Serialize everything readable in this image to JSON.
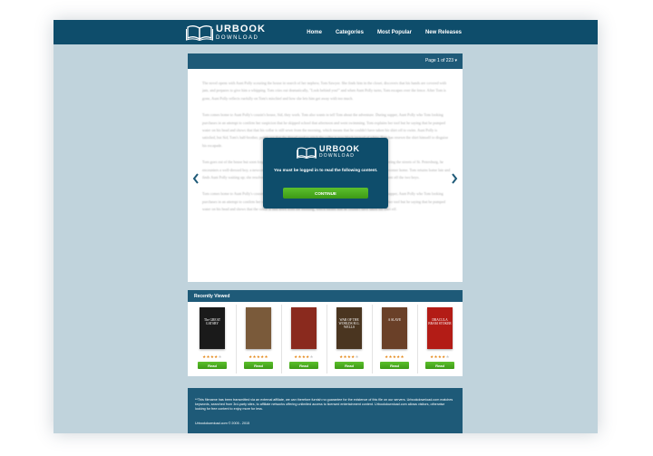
{
  "brand": {
    "line1": "URBOOK",
    "line2": "DOWNLOAD"
  },
  "nav": [
    {
      "label": "Home"
    },
    {
      "label": "Categories"
    },
    {
      "label": "Most Popular"
    },
    {
      "label": "New Releases"
    }
  ],
  "reader": {
    "pager": "Page 1 of 223 ▾",
    "paragraphs": [
      "The novel opens with Aunt Polly scouring the house in search of her nephew, Tom Sawyer. She finds him in the closet, discovers that his hands are covered with jam, and prepares to give him a whipping. Tom cries out dramatically, \"Look behind you!\" and when Aunt Polly turns, Tom escapes over the fence. After Tom is gone, Aunt Polly reflects ruefully on Tom's mischief and how she lets him get away with too much.",
      "Tom comes home to Aunt Polly's cousin's house, Sid, they work. Tom also wants to tell Tom about the adventure. During supper, Aunt Polly who Tom looking purchases in an attempt to confirm her suspicion that he skipped school that afternoon and went swimming. Tom explains her tool but he saying that he pumped water on his head and shows that that his collar is still sewn from the morning, which means that he couldn't have taken his shirt off to swim. Aunt Polly is satisfied, but Sid, Tom's half-brother, points out that the thread used to stitch the collar is now black instead of white. Tom has resewn the shirt himself to disguise his escapade.",
      "Tom goes out of the house but soon forgets his troubles in the excitement of learning a new way of whistling. While wandering the streets of St. Petersburg, he encounters a well-dressed boy, a newcomer to the village, and the two boys scuffle. Tom wins the fight and chases the newcomer home. Tom returns home late and finds Aunt Polly waiting up; she resolves to put Tom to work on Saturday as punishment and eventually closes the movement off the two boys.",
      "Tom comes home to Aunt Polly's cousin's house, Sid, they work. Tom also wants to tell Tom about the adventure. During supper, Aunt Polly who Tom looking purchases in an attempt to confirm her suspicion that he skipped school that afternoon and went swimming. Tom explains her tool but he saying that he pumped water on his head and shows that the collar is still sewn from the morning, which means that he couldn't have taken his shirt off."
    ]
  },
  "modal": {
    "message": "You must be logged in to read the following content.",
    "button": "CONTINUE"
  },
  "recent": {
    "title": "Recently Viewed",
    "read_label": "Read",
    "books": [
      {
        "cover_text": "The GREAT GATSBY",
        "bg": "#1a1a1a",
        "rating": 4
      },
      {
        "cover_text": "",
        "bg": "#7a5a3a",
        "rating": 5
      },
      {
        "cover_text": "",
        "bg": "#8a2a1e",
        "rating": 4
      },
      {
        "cover_text": "WAR OF THE WORLDS H.G. WELLS",
        "bg": "#4a3520",
        "rating": 4
      },
      {
        "cover_text": "A SLAVE",
        "bg": "#6a4028",
        "rating": 5
      },
      {
        "cover_text": "DRACULA BRAM STOKER",
        "bg": "#b31c16",
        "rating": 4
      }
    ]
  },
  "footer": {
    "disclaimer": "**This filename has been transmitted via an external affiliate, we can therefore furnish no guarantee for the existence of this file on our servers. Urbookdownload.com matches keywords, searched from 3rd-party sites, to affiliate networks offering unlimited access to licensed entertainment content. Urbookdownload.com allows visitors, otherwise looking for free content to enjoy more for less.",
    "copyright": "Urbookdownload.com © 2005 - 2015"
  }
}
